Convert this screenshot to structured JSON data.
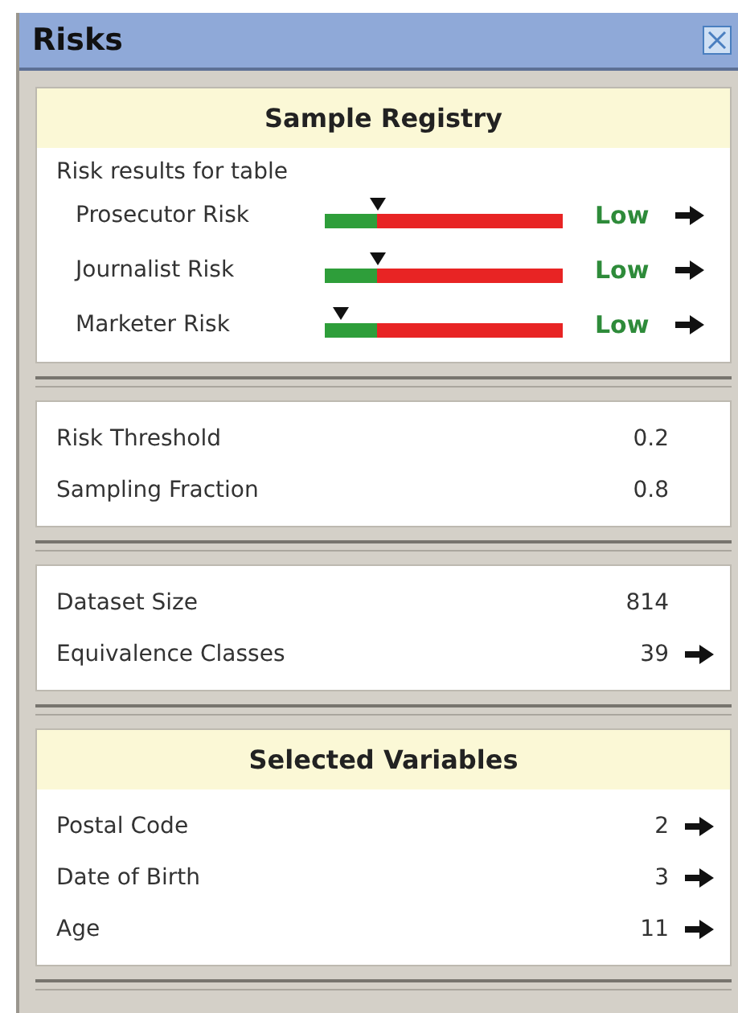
{
  "window": {
    "title": "Risks"
  },
  "registry": {
    "title": "Sample Registry",
    "subtitle": "Risk results for table",
    "risks": [
      {
        "name": "Prosecutor Risk",
        "level": 0.22,
        "rating": "Low"
      },
      {
        "name": "Journalist Risk",
        "level": 0.22,
        "rating": "Low"
      },
      {
        "name": "Marketer Risk",
        "level": 0.07,
        "rating": "Low"
      }
    ]
  },
  "parameters": [
    {
      "label": "Risk Threshold",
      "value": "0.2",
      "link": false
    },
    {
      "label": "Sampling Fraction",
      "value": "0.8",
      "link": false
    }
  ],
  "dataset": [
    {
      "label": "Dataset Size",
      "value": "814",
      "link": false
    },
    {
      "label": "Equivalence Classes",
      "value": "39",
      "link": true
    }
  ],
  "variables": {
    "title": "Selected Variables",
    "items": [
      {
        "label": "Postal Code",
        "value": "2",
        "link": true
      },
      {
        "label": "Date of Birth",
        "value": "3",
        "link": true
      },
      {
        "label": "Age",
        "value": "11",
        "link": true
      }
    ]
  }
}
